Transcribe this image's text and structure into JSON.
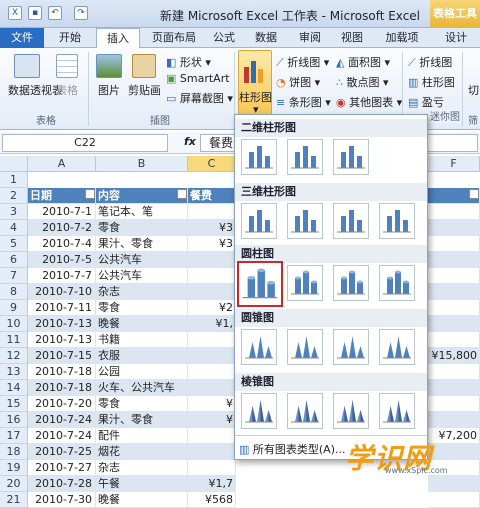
{
  "app": {
    "title": "新建 Microsoft Excel 工作表 - Microsoft Excel",
    "context_tab": "表格工具"
  },
  "tabs": [
    "文件",
    "开始",
    "插入",
    "页面布局",
    "公式",
    "数据",
    "审阅",
    "视图",
    "加载项",
    "设计"
  ],
  "active_tab": "插入",
  "ribbon": {
    "pivot": "数据透视表",
    "table": "表格",
    "group_table": "表格",
    "picture": "图片",
    "clipart": "剪贴画",
    "shapes": "形状",
    "smartart": "SmartArt",
    "screenshot": "屏幕截图",
    "group_illustrations": "插图",
    "column_chart": "柱形图",
    "line_chart": "折线图",
    "pie_chart": "饼图",
    "bar_chart": "条形图",
    "area_chart": "面积图",
    "scatter_chart": "散点图",
    "other_chart": "其他图表",
    "spark_line": "折线图",
    "spark_column": "柱形图",
    "spark_winloss": "盈亏",
    "group_sparklines": "迷你图",
    "group_filter": "筛",
    "slicer": "切"
  },
  "formula_bar": {
    "name_box": "C22",
    "fx": "fx",
    "content": "餐费"
  },
  "columns": [
    "A",
    "B",
    "C",
    "F"
  ],
  "header_row": {
    "date": "日期",
    "content": "内容",
    "cost": "餐费"
  },
  "rows": [
    {
      "n": "3",
      "date": "2010-7-1",
      "content": "笔记本、笔",
      "cost": ""
    },
    {
      "n": "4",
      "date": "2010-7-2",
      "content": "零食",
      "cost": "¥3"
    },
    {
      "n": "5",
      "date": "2010-7-4",
      "content": "果汁、零食",
      "cost": "¥3"
    },
    {
      "n": "6",
      "date": "2010-7-5",
      "content": "公共汽车",
      "cost": ""
    },
    {
      "n": "7",
      "date": "2010-7-7",
      "content": "公共汽车",
      "cost": ""
    },
    {
      "n": "8",
      "date": "2010-7-10",
      "content": "杂志",
      "cost": ""
    },
    {
      "n": "9",
      "date": "2010-7-11",
      "content": "零食",
      "cost": "¥2"
    },
    {
      "n": "10",
      "date": "2010-7-13",
      "content": "晚餐",
      "cost": "¥1,"
    },
    {
      "n": "11",
      "date": "2010-7-13",
      "content": "书籍",
      "cost": ""
    },
    {
      "n": "12",
      "date": "2010-7-15",
      "content": "衣服",
      "cost": ""
    },
    {
      "n": "13",
      "date": "2010-7-18",
      "content": "公园",
      "cost": ""
    },
    {
      "n": "14",
      "date": "2010-7-18",
      "content": "火车、公共汽车",
      "cost": ""
    },
    {
      "n": "15",
      "date": "2010-7-20",
      "content": "零食",
      "cost": "¥"
    },
    {
      "n": "16",
      "date": "2010-7-24",
      "content": "果汁、零食",
      "cost": "¥"
    },
    {
      "n": "17",
      "date": "2010-7-24",
      "content": "配件",
      "cost": ""
    },
    {
      "n": "18",
      "date": "2010-7-25",
      "content": "烟花",
      "cost": ""
    },
    {
      "n": "19",
      "date": "2010-7-27",
      "content": "杂志",
      "cost": ""
    },
    {
      "n": "20",
      "date": "2010-7-28",
      "content": "午餐",
      "cost": "¥1,7"
    },
    {
      "n": "21",
      "date": "2010-7-30",
      "content": "晚餐",
      "cost": "¥568"
    }
  ],
  "col_f_values": {
    "r12": "¥15,800",
    "r17": "¥7,200"
  },
  "dropdown": {
    "sec1": "二维柱形图",
    "sec2": "三维柱形图",
    "sec3": "圆柱图",
    "sec4": "圆锥图",
    "sec5": "棱锥图",
    "all_types": "所有图表类型(A)..."
  },
  "watermark": {
    "text": "学识网",
    "url": "www.xSpic.com"
  },
  "colors": {
    "accent": "#2a6cc4",
    "header": "#4f81bd",
    "band": "#dce6f1",
    "highlight": "#d0262a"
  }
}
